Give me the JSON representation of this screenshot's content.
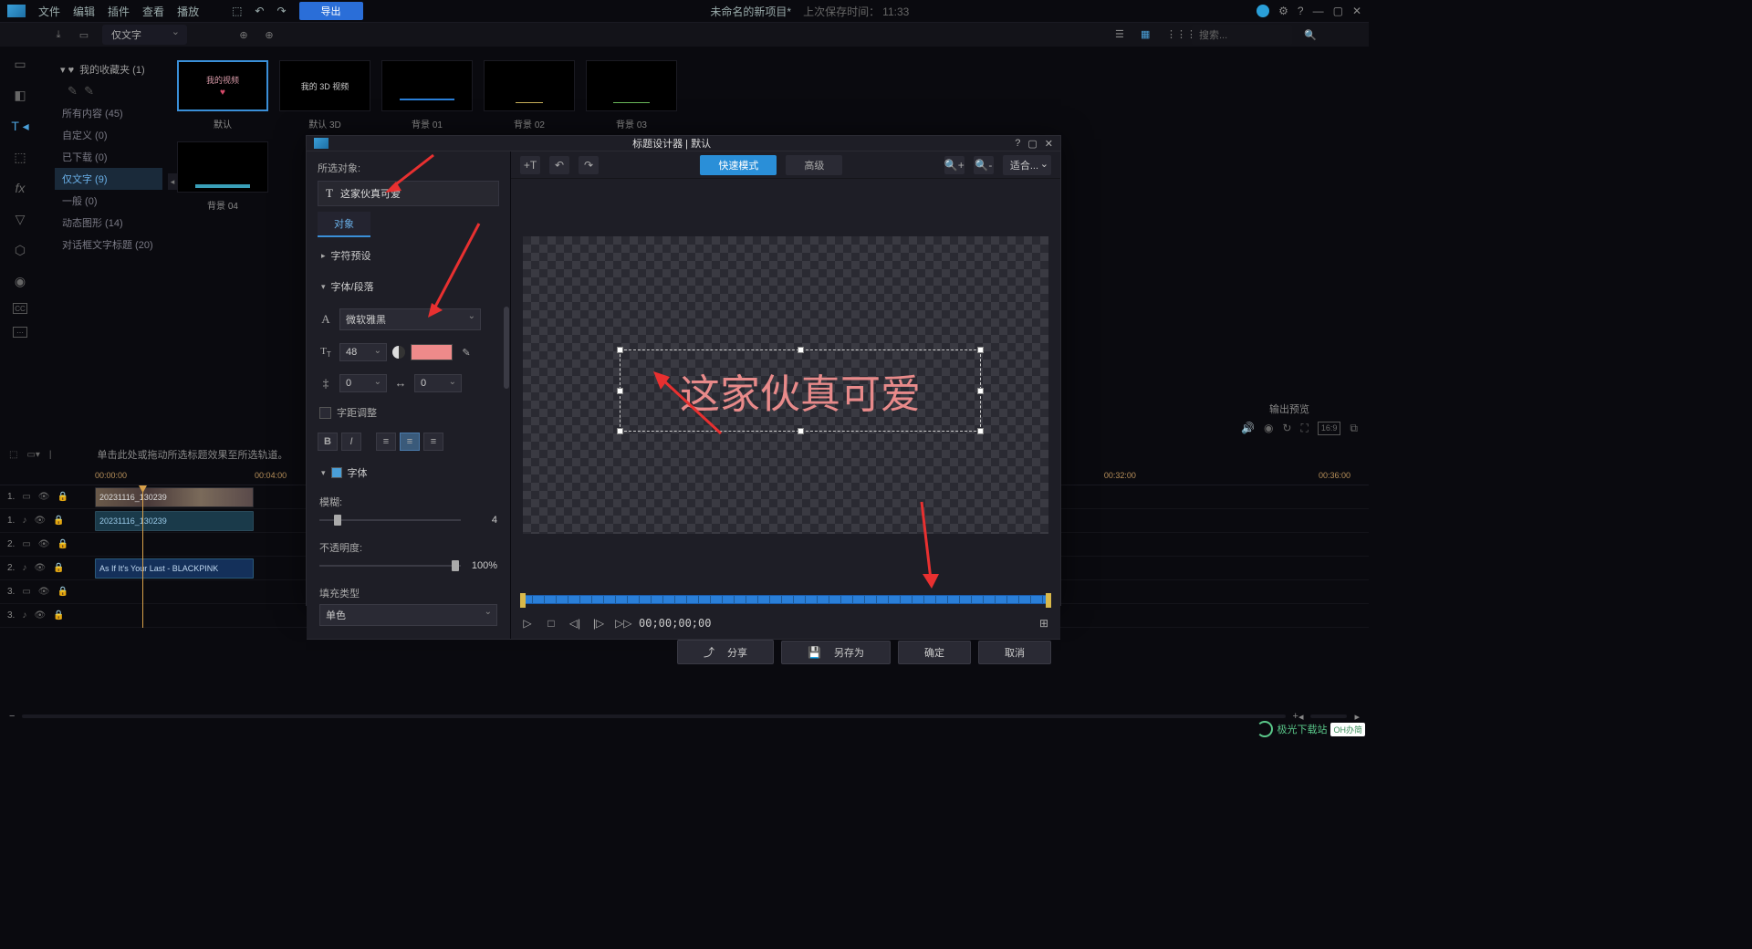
{
  "menubar": {
    "items": [
      "文件",
      "编辑",
      "插件",
      "查看",
      "播放"
    ],
    "export": "导出",
    "title": "未命名的新项目*",
    "saved_prefix": "上次保存时间：",
    "saved_time": "11:33"
  },
  "toolrow": {
    "filter": "仅文字",
    "search_placeholder": "搜索..."
  },
  "browser": {
    "favorites": "我的收藏夹 (1)",
    "tree": [
      {
        "label": "所有内容 (45)",
        "active": false
      },
      {
        "label": "自定义 (0)",
        "active": false
      },
      {
        "label": "已下载 (0)",
        "active": false
      },
      {
        "label": "仅文字 (9)",
        "active": true
      },
      {
        "label": "一般 (0)",
        "active": false
      },
      {
        "label": "动态图形 (14)",
        "active": false
      },
      {
        "label": "对话框文字标题 (20)",
        "active": false
      }
    ],
    "thumbs": [
      {
        "title": "我的视频",
        "label": "默认",
        "selected": true,
        "style": "pinkheart"
      },
      {
        "title": "我的 3D 视频",
        "label": "默认 3D",
        "selected": false,
        "style": "plain"
      },
      {
        "title": "",
        "label": "背景 01",
        "selected": false,
        "style": "bluebar"
      },
      {
        "title": "",
        "label": "背景 02",
        "selected": false,
        "style": "yellowline"
      },
      {
        "title": "",
        "label": "背景 03",
        "selected": false,
        "style": "greenline"
      },
      {
        "title": "",
        "label": "背景 04",
        "selected": false,
        "style": "cyanbar"
      }
    ]
  },
  "right_preview": {
    "label": "输出预览",
    "aspect": "16:9"
  },
  "timeline": {
    "hint": "单击此处或拖动所选标题效果至所选轨道。",
    "times": [
      "00:00:00",
      "00:04:00",
      "00:32:00",
      "00:36:00"
    ],
    "tracks": [
      {
        "idx": "1.",
        "type": "video",
        "clip": "20231116_130239"
      },
      {
        "idx": "1.",
        "type": "audio",
        "clip": "20231116_130239"
      },
      {
        "idx": "2.",
        "type": "video",
        "clip": ""
      },
      {
        "idx": "2.",
        "type": "audio",
        "clip": "As If It's Your Last - BLACKPINK"
      },
      {
        "idx": "3.",
        "type": "video",
        "clip": ""
      },
      {
        "idx": "3.",
        "type": "audio",
        "clip": ""
      }
    ]
  },
  "modal": {
    "title": "标题设计器  |  默认",
    "selected_label": "所选对象:",
    "selected_text": "这家伙真可爱",
    "tab_object": "对象",
    "preset_head": "字符预设",
    "para_head": "字体/段落",
    "font_name": "微软雅黑",
    "font_size": "48",
    "line_sp": "0",
    "char_sp": "0",
    "kerning": "字距调整",
    "font_section": "字体",
    "blur_label": "模糊:",
    "blur_val": "4",
    "opacity_label": "不透明度:",
    "opacity_val": "100%",
    "fill_label": "填充类型",
    "fill_val": "单色",
    "mode_fast": "快速模式",
    "mode_adv": "高级",
    "fit": "适合...",
    "preview_text": "这家伙真可爱",
    "timecode": "00;00;00;00",
    "footer": {
      "share": "分享",
      "saveas": "另存为",
      "ok": "确定",
      "cancel": "取消"
    }
  },
  "colors": {
    "text_fill": "#ee8a8a",
    "accent": "#2a8fd8"
  },
  "watermark": {
    "site": "极光下载站",
    "badge": "OH办简"
  }
}
